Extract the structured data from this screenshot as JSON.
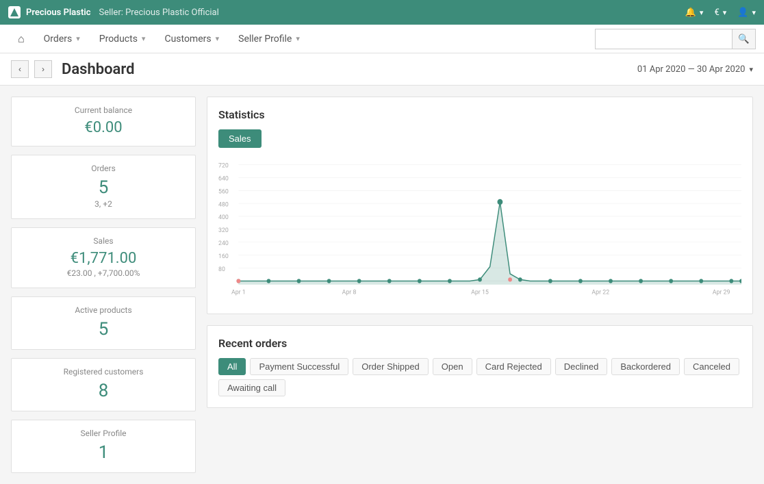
{
  "topbar": {
    "logo_alt": "Precious Plastic logo",
    "app_name": "Precious Plastic",
    "seller_label": "Seller: Precious Plastic Official",
    "bell_icon": "bell",
    "currency_icon": "€",
    "user_icon": "user"
  },
  "mainnav": {
    "home_label": "⌂",
    "items": [
      {
        "label": "Orders",
        "has_dropdown": true
      },
      {
        "label": "Products",
        "has_dropdown": true
      },
      {
        "label": "Customers",
        "has_dropdown": true
      },
      {
        "label": "Seller Profile",
        "has_dropdown": true
      }
    ],
    "search_placeholder": ""
  },
  "page_header": {
    "title": "Dashboard",
    "date_range": "01 Apr 2020 — 30 Apr 2020"
  },
  "stats_cards": [
    {
      "id": "current-balance",
      "label": "Current balance",
      "value": "€0.00",
      "sub": null
    },
    {
      "id": "orders",
      "label": "Orders",
      "value": "5",
      "sub": "3, +2"
    },
    {
      "id": "sales",
      "label": "Sales",
      "value": "€1,771.00",
      "sub": "€23.00 , +7,700.00%"
    },
    {
      "id": "active-products",
      "label": "Active products",
      "value": "5",
      "sub": null
    },
    {
      "id": "registered-customers",
      "label": "Registered customers",
      "value": "8",
      "sub": null
    },
    {
      "id": "seller-profile",
      "label": "Seller Profile",
      "value": "1",
      "sub": null
    }
  ],
  "statistics": {
    "title": "Statistics",
    "tabs": [
      "Sales"
    ],
    "active_tab": "Sales",
    "x_labels": [
      "Apr 1",
      "Apr 8",
      "Apr 15",
      "Apr 22",
      "Apr 29"
    ],
    "y_labels": [
      "720",
      "640",
      "560",
      "480",
      "400",
      "320",
      "240",
      "160",
      "80"
    ]
  },
  "recent_orders": {
    "title": "Recent orders",
    "filters": [
      {
        "label": "All",
        "active": true
      },
      {
        "label": "Payment Successful",
        "active": false
      },
      {
        "label": "Order Shipped",
        "active": false
      },
      {
        "label": "Open",
        "active": false
      },
      {
        "label": "Card Rejected",
        "active": false
      },
      {
        "label": "Declined",
        "active": false
      },
      {
        "label": "Backordered",
        "active": false
      },
      {
        "label": "Canceled",
        "active": false
      },
      {
        "label": "Awaiting call",
        "active": false
      }
    ]
  }
}
